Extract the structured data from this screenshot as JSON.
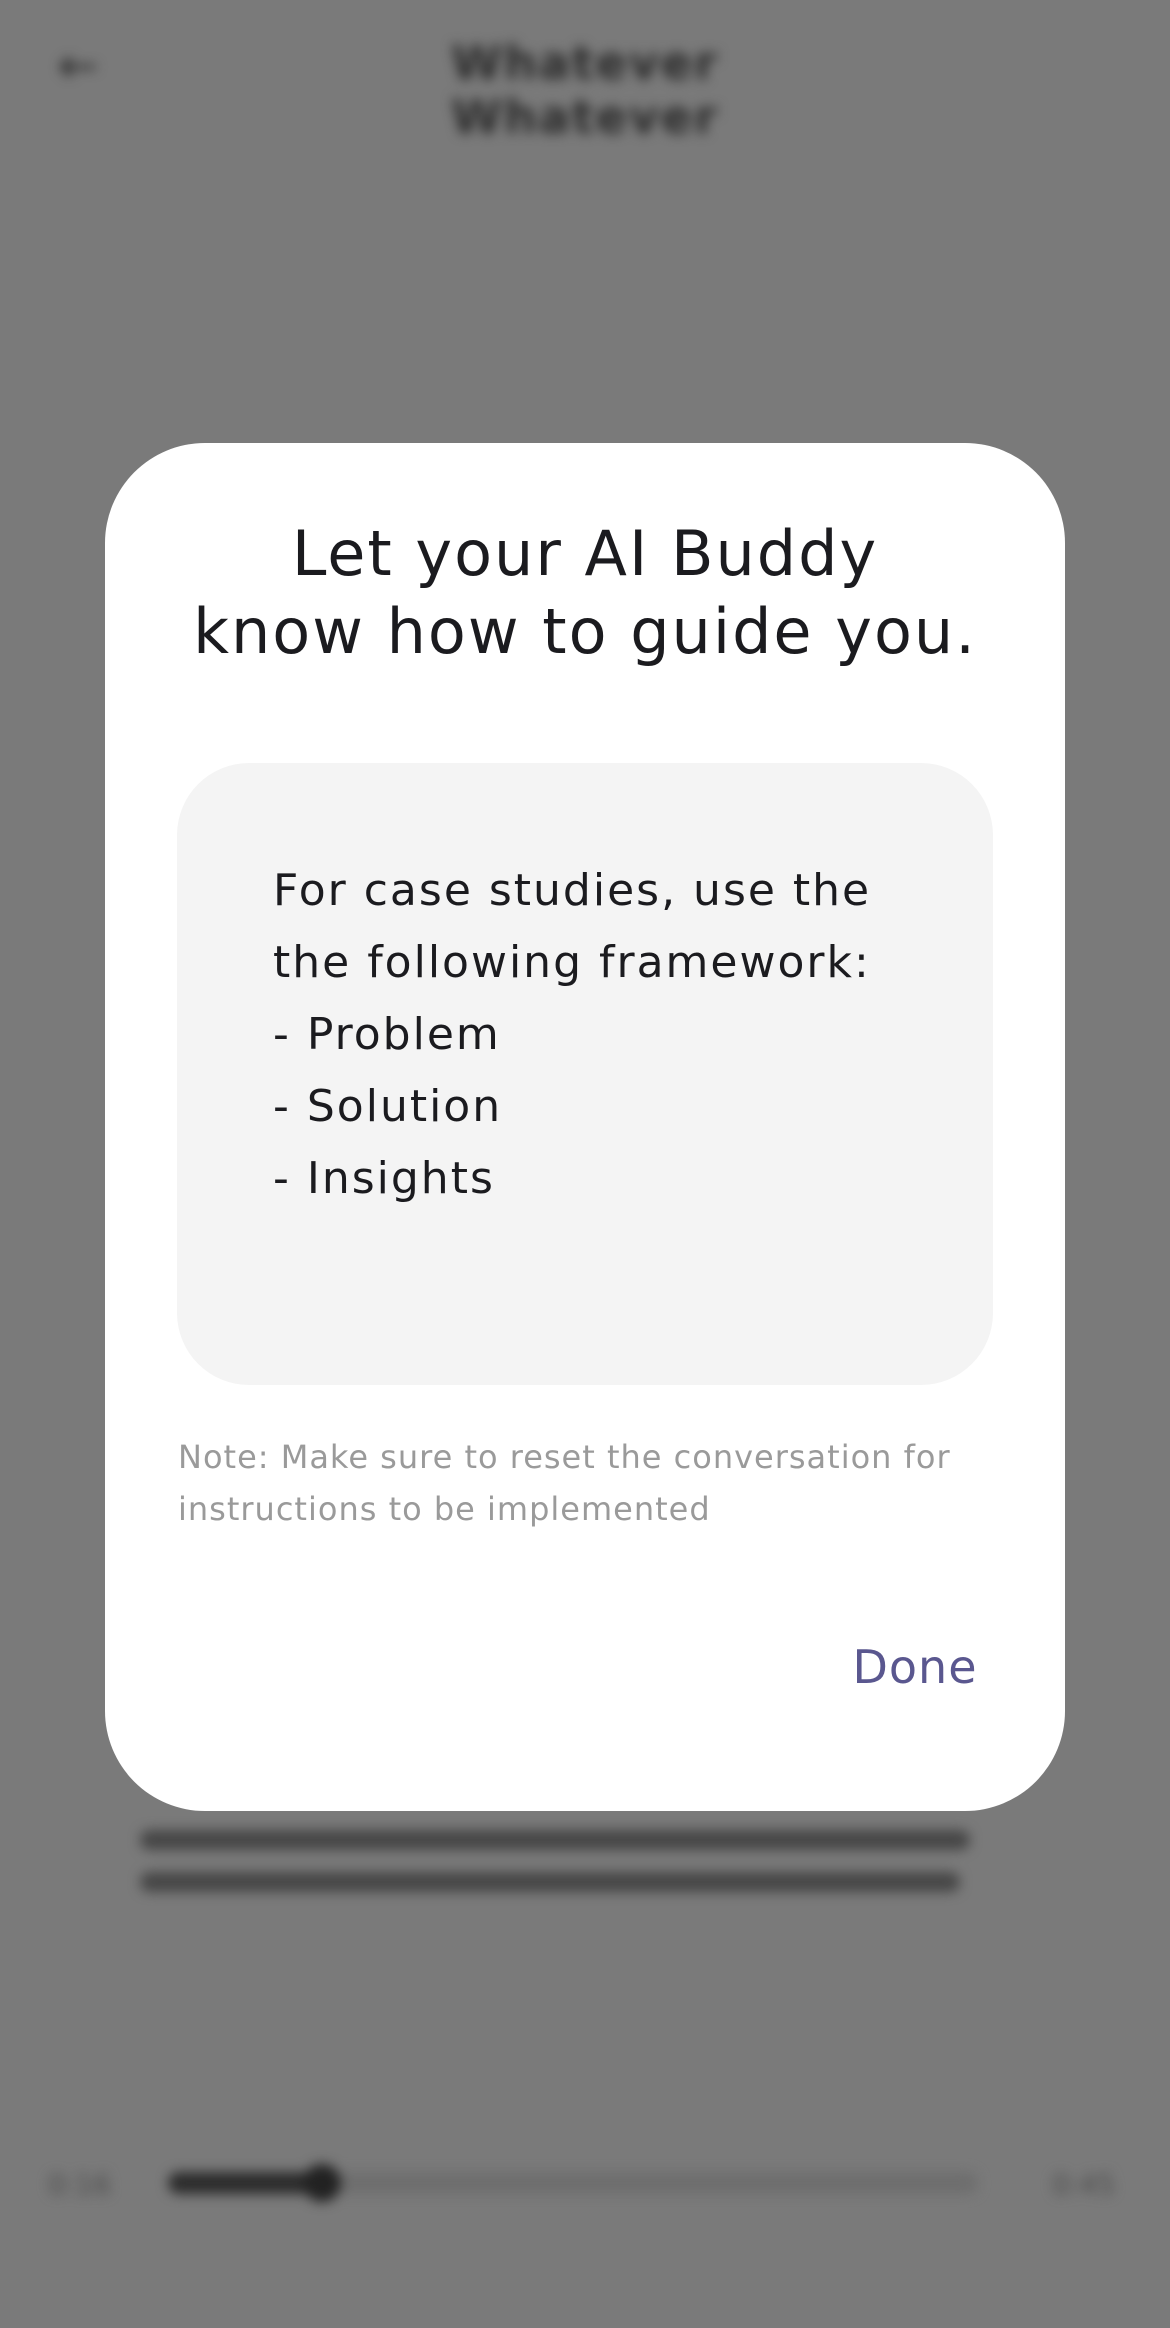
{
  "background": {
    "page_title": "Whatever Whatever",
    "time_elapsed": "0:16",
    "time_total": "0:45",
    "progress": 0.19
  },
  "dialog": {
    "title": "Let your AI Buddy\nknow how to guide you.",
    "instructions": "For case studies, use the\nthe following framework:\n- Problem\n- Solution\n- Insights",
    "note": "Note: Make sure to reset the conversation for instructions to be implemented",
    "done_label": "Done"
  },
  "colors": {
    "overlay": "#7a7a7a",
    "dialog_bg": "#ffffff",
    "input_bg": "#f4f4f4",
    "accent": "#5a578f",
    "note_text": "#9a9a9a"
  }
}
